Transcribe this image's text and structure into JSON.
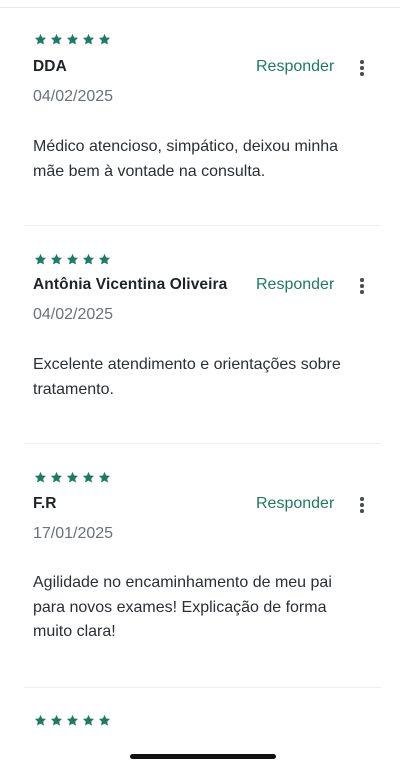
{
  "colors": {
    "star": "#1d7b63",
    "accent": "#1d7b63"
  },
  "reviews": [
    {
      "rating": 5,
      "author": "DDA",
      "respond_label": "Responder",
      "menu_icon": "more-vertical-icon",
      "date": "04/02/2025",
      "text": "Médico atencioso, simpático, deixou minha mãe bem à vontade na consulta."
    },
    {
      "rating": 5,
      "author": "Antônia Vicentina Oliveira",
      "respond_label": "Responder",
      "menu_icon": "more-vertical-icon",
      "date": "04/02/2025",
      "text": "Excelente atendimento e orientações sobre tratamento."
    },
    {
      "rating": 5,
      "author": "F.R",
      "respond_label": "Responder",
      "menu_icon": "more-vertical-icon",
      "date": "17/01/2025",
      "text": "Agilidade no encaminhamento de meu pai para novos exames! Explicação de forma muito clara!"
    },
    {
      "rating": 5
    }
  ]
}
